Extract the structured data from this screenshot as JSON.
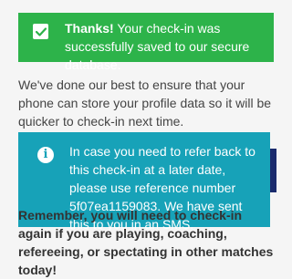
{
  "success_alert": {
    "bold": "Thanks!",
    "text": " Your check-in was successfully saved to our secure database.",
    "color": "#2db34a"
  },
  "intro": {
    "text": "We've done our best to ensure that your phone can store your profile data so it will be quicker to check-in next time."
  },
  "info_alert": {
    "icon": "info-icon",
    "text": "In case you need to refer back to this check-in at a later date, please use reference number 5f07ea1159083. We have sent this to you in an SMS.",
    "color": "#17a2b8"
  },
  "side_tab": {
    "color": "#1a2b6d"
  },
  "reminder": {
    "text": "Remember, you will need to check-in again if you are playing, coaching, refereeing, or spectating in other matches today!"
  }
}
